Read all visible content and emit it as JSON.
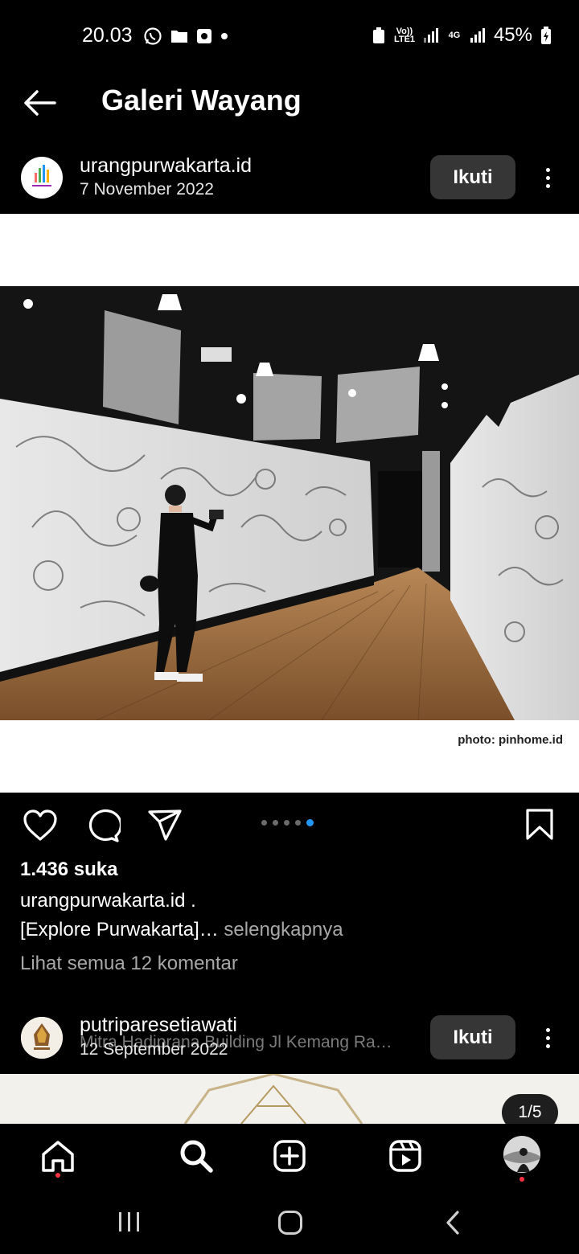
{
  "status_bar": {
    "time": "20.03",
    "volte_label": "Vo)) LTE1",
    "network_label": "4G",
    "battery_percent": "45%"
  },
  "header": {
    "title": "Galeri Wayang"
  },
  "post1": {
    "username": "urangpurwakarta.id",
    "date": "7 November 2022",
    "follow_label": "Ikuti",
    "photo_credit": "photo: pinhome.id",
    "likes": "1.436 suka",
    "caption_user": "urangpurwakarta.id .",
    "caption_text": "[Explore Purwakarta]…",
    "caption_more": " selengkapnya",
    "view_comments": "Lihat semua 12 komentar",
    "carousel": {
      "count": 5,
      "active_index": 4
    }
  },
  "post2": {
    "username": "putriparesetiawati",
    "location": "Mitra Hadiprana Building Jl Kemang Ra…",
    "date": "12 September 2022",
    "follow_label": "Ikuti",
    "page_counter": "1/5"
  },
  "colors": {
    "background": "#000000",
    "follow_button": "#363636",
    "carousel_active": "#2196f3",
    "notification_dot": "#ff3040",
    "muted_text": "#a8a8a8"
  },
  "bottom_nav": {
    "items": [
      "home-icon",
      "search-icon",
      "create-icon",
      "reels-icon",
      "profile-avatar"
    ],
    "active": "search-icon"
  }
}
